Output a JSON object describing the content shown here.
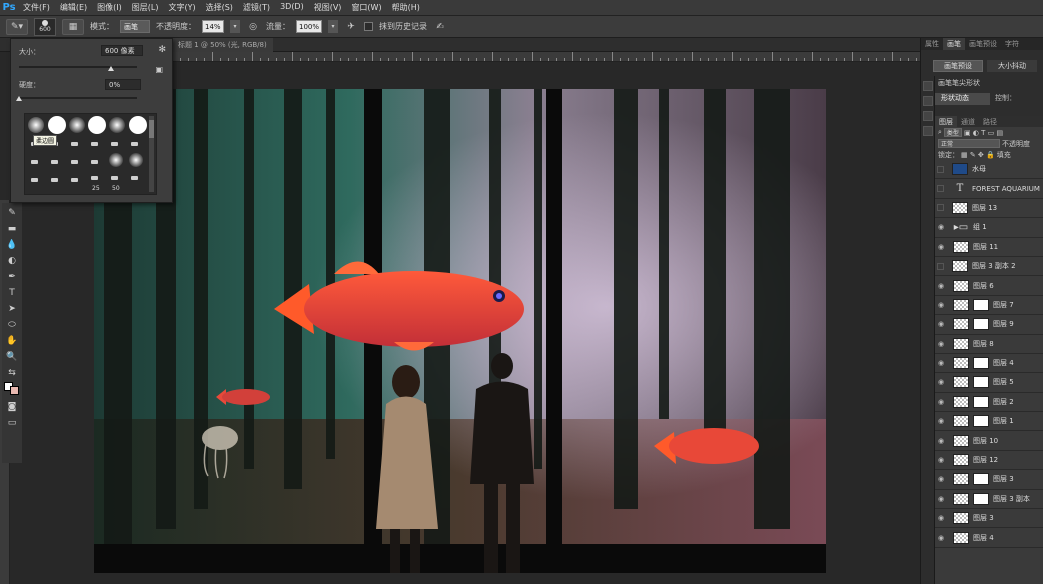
{
  "menubar": {
    "logo": "Ps",
    "items": [
      "文件(F)",
      "编辑(E)",
      "图像(I)",
      "图层(L)",
      "文字(Y)",
      "选择(S)",
      "滤镜(T)",
      "3D(D)",
      "视图(V)",
      "窗口(W)",
      "帮助(H)"
    ]
  },
  "options": {
    "brush_size": "600",
    "mode_label": "模式：",
    "mode_value": "画笔",
    "opacity_label": "不透明度：",
    "opacity_value": "14%",
    "flow_label": "流量：",
    "flow_value": "100%",
    "erase_history_label": "抹到历史记录"
  },
  "document": {
    "tab_title": "标题 1 @ 50% (光, RGB/8)"
  },
  "brush_popup": {
    "size_label": "大小：",
    "size_value": "600 像素",
    "hardness_label": "硬度：",
    "hardness_value": "0%",
    "size_fraction": 0.78,
    "hardness_fraction": 0.0,
    "tooltip": "柔边圆",
    "preset_numbers": [
      "25",
      "50"
    ]
  },
  "panels": {
    "top_tabs": [
      "属性",
      "画笔",
      "画笔预设",
      "字符"
    ],
    "brush_presets_btn": "画笔预设",
    "size_btn": "大小抖动",
    "brush_tip_label": "画笔笔尖形状",
    "shape_dynamics_label": "形状动态",
    "control_label": "控制："
  },
  "layers_panel": {
    "tabs": [
      "图层",
      "通道",
      "路径"
    ],
    "kind_label": "类型",
    "blend_mode": "正常",
    "opacity_label": "不透明度",
    "lock_label": "锁定：",
    "fill_label": "填充",
    "layers": [
      {
        "name": "水母",
        "visible": false,
        "type": "image"
      },
      {
        "name": "FOREST AQUARIUM",
        "visible": false,
        "type": "text"
      },
      {
        "name": "图层 13",
        "visible": false,
        "type": "plain"
      },
      {
        "name": "组 1",
        "visible": true,
        "type": "group"
      },
      {
        "name": "图层 11",
        "visible": true,
        "type": "plain"
      },
      {
        "name": "图层 3 副本 2",
        "visible": false,
        "type": "plain"
      },
      {
        "name": "图层 6",
        "visible": true,
        "type": "plain"
      },
      {
        "name": "图层 7",
        "visible": true,
        "type": "mask"
      },
      {
        "name": "图层 9",
        "visible": true,
        "type": "mask"
      },
      {
        "name": "图层 8",
        "visible": true,
        "type": "plain"
      },
      {
        "name": "图层 4",
        "visible": true,
        "type": "mask"
      },
      {
        "name": "图层 5",
        "visible": true,
        "type": "mask"
      },
      {
        "name": "图层 2",
        "visible": true,
        "type": "mask"
      },
      {
        "name": "图层 1",
        "visible": true,
        "type": "mask"
      },
      {
        "name": "图层 10",
        "visible": true,
        "type": "plain"
      },
      {
        "name": "图层 12",
        "visible": true,
        "type": "plain"
      },
      {
        "name": "图层 3",
        "visible": true,
        "type": "mask"
      },
      {
        "name": "图层 3 副本",
        "visible": true,
        "type": "mask"
      },
      {
        "name": "图层 3",
        "visible": true,
        "type": "plain"
      },
      {
        "name": "图层 4",
        "visible": true,
        "type": "plain"
      }
    ]
  }
}
